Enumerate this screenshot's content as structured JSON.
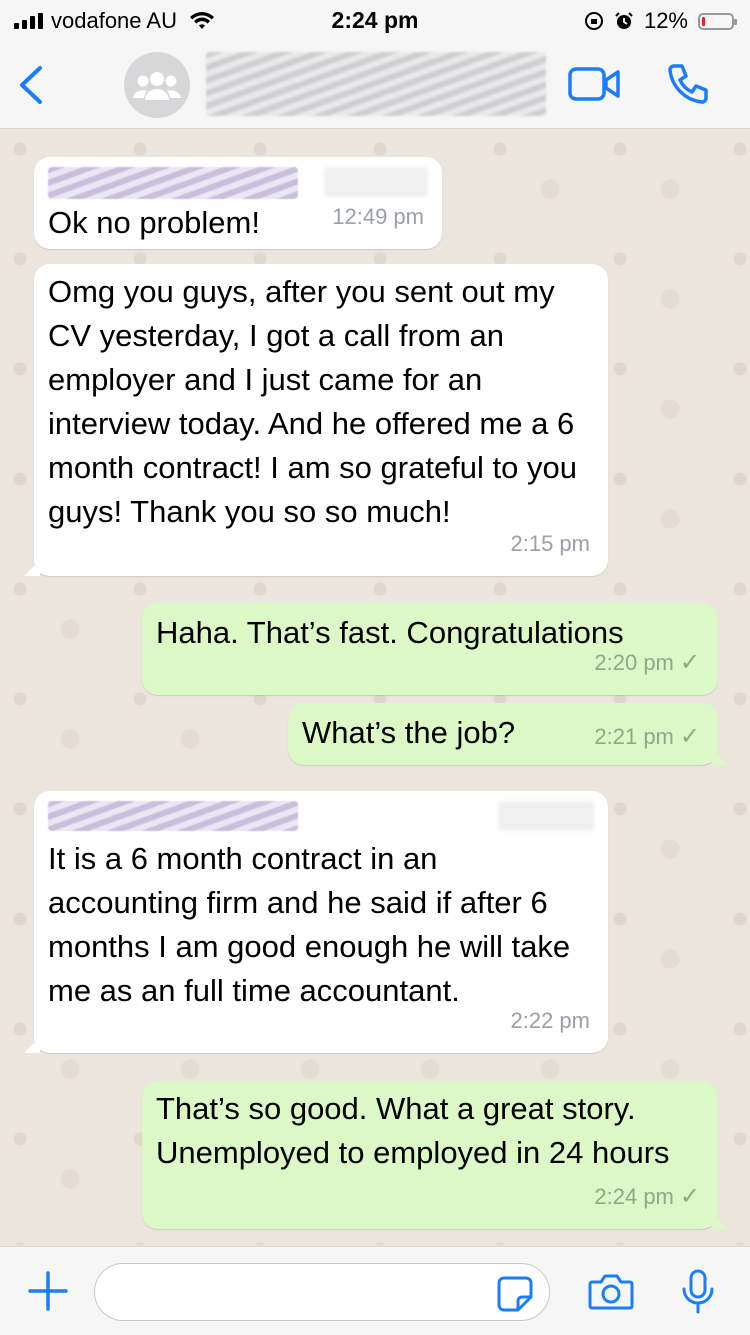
{
  "status_bar": {
    "carrier": "vodafone AU",
    "time": "2:24 pm",
    "battery_percent": "12%",
    "battery_level": 0.12,
    "battery_color": "#e0262b"
  },
  "header": {
    "back_icon": "chevron-left-icon",
    "avatar_icon": "group-icon",
    "video_icon": "video-camera-icon",
    "call_icon": "phone-icon",
    "accent_color": "#1a7efb"
  },
  "messages": [
    {
      "direction": "in",
      "text": "Ok no problem!",
      "time": "12:49 pm"
    },
    {
      "direction": "in",
      "text": "Omg you guys, after you sent out my CV yesterday, I got a call from an employer and I just came for an interview today. And he offered me a 6 month contract! I am so grateful to you guys! Thank you so so much!",
      "time": "2:15 pm"
    },
    {
      "direction": "out",
      "text": "Haha. That’s fast. Congratulations",
      "time": "2:20 pm",
      "status": "✓"
    },
    {
      "direction": "out",
      "text": "What’s the job?",
      "time": "2:21 pm",
      "status": "✓"
    },
    {
      "direction": "in",
      "text": "It is a 6 month contract in an accounting firm and he said if after 6 months I am good enough he will take me as an full time accountant.",
      "time": "2:22 pm"
    },
    {
      "direction": "out",
      "text": "That’s so good. What a great story. Unemployed to employed in 24 hours",
      "time": "2:24 pm",
      "status": "✓"
    }
  ],
  "input_bar": {
    "plus_icon": "plus-icon",
    "input_value": "",
    "sticker_icon": "sticker-icon",
    "camera_icon": "camera-icon",
    "mic_icon": "microphone-icon"
  },
  "colors": {
    "incoming_bubble": "#ffffff",
    "outgoing_bubble": "#dcf8c6",
    "chat_background": "#ece5dd"
  }
}
